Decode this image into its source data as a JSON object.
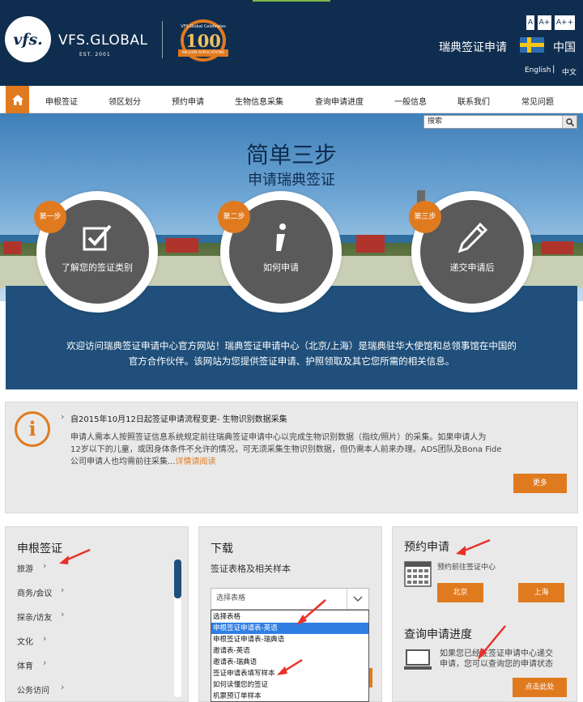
{
  "header": {
    "logo_text": "vfs.",
    "brand": "VFS.GLOBAL",
    "brand_sub": "EST. 2001",
    "badge_top": "VFS Global Celebrates",
    "badge_num": "100",
    "badge_ribbon": "MILLION APPLICATIONS",
    "font_sizes": [
      "A",
      "A+",
      "A++"
    ],
    "country_title": "瑞典签证申请",
    "country": "中国",
    "lang_en": "English",
    "lang_sep": "|",
    "lang_zh": "中文"
  },
  "nav": {
    "items": [
      "申根签证",
      "领区划分",
      "预约申请",
      "生物信息采集",
      "查询申请进度",
      "一般信息",
      "联系我们",
      "常见问题"
    ]
  },
  "search": {
    "placeholder": "搜索"
  },
  "hero": {
    "title": "简单三步",
    "subtitle": "申请瑞典签证",
    "steps": [
      {
        "tag": "第一步",
        "label": "了解您的签证类别",
        "icon": "checkbox-icon"
      },
      {
        "tag": "第二步",
        "label": "如何申请",
        "icon": "info-icon"
      },
      {
        "tag": "第三步",
        "label": "递交申请后",
        "icon": "pencil-icon"
      }
    ],
    "welcome_line1": "欢迎访问瑞典签证申请中心官方网站！瑞典签证申请中心（北京/上海）是瑞典驻华大使馆和总领事馆在中国的",
    "welcome_line2": "官方合作伙伴。该网站为您提供签证申请、护照领取及其它您所需的相关信息。"
  },
  "notice": {
    "title": "自2015年10月12日起签证申请流程变更- 生物识别数据采集",
    "body_line1": "申请人需本人按照签证信息系统规定前往瑞典签证申请中心以完成生物识别数据（指纹/照片）的采集。如果申请人为",
    "body_line2": "12岁以下的儿童，或因身体条件不允许的情况，可无须采集生物识别数据，但仍需本人前来办理。ADS团队及Bona Fide",
    "body_line3": "公司申请人也均需前往采集...",
    "read_more": "详情请阅读",
    "more_button": "更多"
  },
  "schengen": {
    "title": "申根签证",
    "items": [
      "旅游",
      "商务/会议",
      "探亲/访友",
      "文化",
      "体育",
      "公务访问"
    ]
  },
  "download": {
    "title": "下载",
    "subtitle": "签证表格及相关样本",
    "select_value": "选择表格",
    "options": [
      "选择表格",
      "申根签证申请表-英语",
      "申根签证申请表-瑞典语",
      "邀请表-英语",
      "邀请表-瑞典语",
      "签证申请表填写样本",
      "如何读懂您的签证",
      "机票预订单样本"
    ],
    "selected_index": 1
  },
  "appointment": {
    "title": "预约申请",
    "desc": "预约前往签证中心",
    "beijing": "北京",
    "shanghai": "上海"
  },
  "track": {
    "title": "查询申请进度",
    "desc_line1": "如果您已经在签证申请中心递交",
    "desc_line2": "申请，您可以查询您的申请状态",
    "button": "点击此处"
  },
  "colors": {
    "navy": "#0f2d4f",
    "orange": "#e07a1f",
    "panel_blue": "#1f4f7a",
    "annotation_red": "#e8312a"
  }
}
